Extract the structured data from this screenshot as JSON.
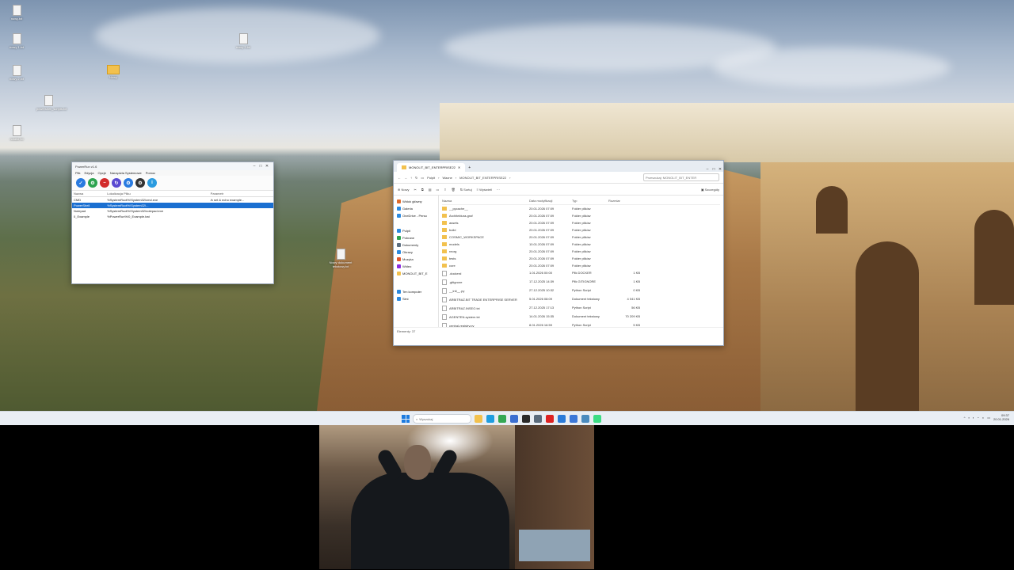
{
  "desktop": {
    "icons": [
      {
        "label": "nowy.txt",
        "type": "file"
      },
      {
        "label": "nowy 1.txt",
        "type": "file"
      },
      {
        "label": "nowy 2.txt",
        "type": "file"
      },
      {
        "label": "Nowy",
        "type": "folder"
      },
      {
        "label": "nowy 3.txt",
        "type": "file"
      },
      {
        "label": "powershell_scripts.txt",
        "type": "file"
      },
      {
        "label": "notatki.txt",
        "type": "file"
      },
      {
        "label": "Nowy dokument tekstowy.txt",
        "type": "file"
      }
    ]
  },
  "powerrun": {
    "title": "PowerRun v1.6",
    "menu": [
      "Plik",
      "Edycja",
      "Opcje",
      "Narzędzia Systemowe",
      "Pomoc"
    ],
    "toolbar_icons": [
      "check-icon",
      "settings-icon",
      "stop-icon",
      "refresh-icon",
      "gear-icon",
      "cog-icon",
      "info-icon"
    ],
    "columns": [
      "Nazwa",
      "Lokalizacja Pliku",
      "Parametr"
    ],
    "rows": [
      {
        "name": "CMD",
        "path": "%SystemRoot%\\System32\\cmd.exe",
        "param": "/k set & echo example...",
        "selected": false
      },
      {
        "name": "PowerShell",
        "path": "%SystemRoot%\\System32\\...",
        "param": "",
        "selected": true
      },
      {
        "name": "Notepad",
        "path": "%SystemRoot%\\System32\\notepad.exe",
        "param": "",
        "selected": false
      },
      {
        "name": "0_Example",
        "path": "%PowerRun%\\0_Example.bat",
        "param": "",
        "selected": false
      }
    ]
  },
  "explorer": {
    "tab_title": "MONOLIT_BIT_ENTERPRISE22",
    "path": [
      "Pulpit",
      "Wazne",
      "MONOLIT_BIT_ENTERPRISE22"
    ],
    "search_placeholder": "Przeszukaj: MONOLIT_BIT_ENTER",
    "cmd": {
      "new": "Nowy",
      "sort": "Sortuj",
      "view": "Wyświetl",
      "details": "Szczegóły"
    },
    "nav": [
      {
        "label": "Widok główny",
        "color": "#e06b2c"
      },
      {
        "label": "Galeria",
        "color": "#2c8ae0"
      },
      {
        "label": "OneDrive - Perso",
        "color": "#2c8ae0"
      },
      {
        "label": "Pulpit",
        "color": "#2c8ae0"
      },
      {
        "label": "Pobrane",
        "color": "#2ca34f"
      },
      {
        "label": "Dokumenty",
        "color": "#5c6e80"
      },
      {
        "label": "Obrazy",
        "color": "#2c8ae0"
      },
      {
        "label": "Muzyka",
        "color": "#e0542c"
      },
      {
        "label": "Wideo",
        "color": "#8a2ce0"
      },
      {
        "label": "MONOLIT_BIT_E",
        "color": "#f2c14e"
      },
      {
        "label": "Ten komputer",
        "color": "#2c8ae0"
      },
      {
        "label": "Sieć",
        "color": "#2c8ae0"
      }
    ],
    "columns": [
      "Nazwa",
      "Data modyfikacji",
      "Typ",
      "Rozmiar"
    ],
    "files": [
      {
        "name": "__pycache__",
        "date": "20.01.2026 07:09",
        "type": "Folder plików",
        "size": "",
        "kind": "folder"
      },
      {
        "name": "Architektura-graf",
        "date": "20.01.2026 07:09",
        "type": "Folder plików",
        "size": "",
        "kind": "folder"
      },
      {
        "name": "assets",
        "date": "20.01.2026 07:09",
        "type": "Folder plików",
        "size": "",
        "kind": "folder"
      },
      {
        "name": "build",
        "date": "20.01.2026 07:09",
        "type": "Folder plików",
        "size": "",
        "kind": "folder"
      },
      {
        "name": "COSMIC_WORKSPACE",
        "date": "20.01.2026 07:09",
        "type": "Folder plików",
        "size": "",
        "kind": "folder"
      },
      {
        "name": "models",
        "date": "10.01.2026 07:09",
        "type": "Folder plików",
        "size": "",
        "kind": "folder"
      },
      {
        "name": "reorg",
        "date": "20.01.2026 07:09",
        "type": "Folder plików",
        "size": "",
        "kind": "folder"
      },
      {
        "name": "tests",
        "date": "20.01.2026 07:09",
        "type": "Folder plików",
        "size": "",
        "kind": "folder"
      },
      {
        "name": "core",
        "date": "20.01.2026 07:09",
        "type": "Folder plików",
        "size": "",
        "kind": "folder"
      },
      {
        "name": ".dockerd",
        "date": "1.01.2026 00:00",
        "type": "Plik DOCKER",
        "size": "1 KB",
        "kind": "file"
      },
      {
        "name": ".gitignore",
        "date": "17.12.2025 14:39",
        "type": "Plik GITIGNORE",
        "size": "1 KB",
        "kind": "file"
      },
      {
        "name": "__init__.py",
        "date": "27.12.2025 10:32",
        "type": "Python Script",
        "size": "0 KB",
        "kind": "file"
      },
      {
        "name": "ARBITRAŻ.BIT TRADE ENTERPRISE SERVER",
        "date": "5.01.2026 08:09",
        "type": "Dokument tekstowy",
        "size": "4 041 KB",
        "kind": "file"
      },
      {
        "name": "ARBITRAZ.INSEO.txt",
        "date": "27.12.2025 17:13",
        "type": "Python Script",
        "size": "56 KB",
        "kind": "file"
      },
      {
        "name": "AGENTEN-system.txt",
        "date": "14.01.2026 15:35",
        "type": "Dokument tekstowy",
        "size": "70 209 KB",
        "kind": "file"
      },
      {
        "name": "central-registry.py",
        "date": "8.01.2026 16:59",
        "type": "Python Script",
        "size": "5 KB",
        "kind": "file"
      }
    ],
    "status": "Elementy: 37"
  },
  "taskbar": {
    "search_placeholder": "Wyszukaj",
    "apps": [
      {
        "name": "explorer-app",
        "color": "#f2c14e"
      },
      {
        "name": "edge-app",
        "color": "#1e9de0"
      },
      {
        "name": "chrome-app",
        "color": "#34a853"
      },
      {
        "name": "store-app",
        "color": "#3b6fd1"
      },
      {
        "name": "terminal-app",
        "color": "#2a2a2a"
      },
      {
        "name": "settings-app",
        "color": "#5a6b7c"
      },
      {
        "name": "ruby-app",
        "color": "#d22"
      },
      {
        "name": "vscode-app",
        "color": "#2b7bd8"
      },
      {
        "name": "docs-app",
        "color": "#3c78d8"
      },
      {
        "name": "python-app",
        "color": "#4b8bbe"
      },
      {
        "name": "android-app",
        "color": "#3ddc84"
      }
    ],
    "time": "09:37",
    "date": "20.01.2026"
  }
}
